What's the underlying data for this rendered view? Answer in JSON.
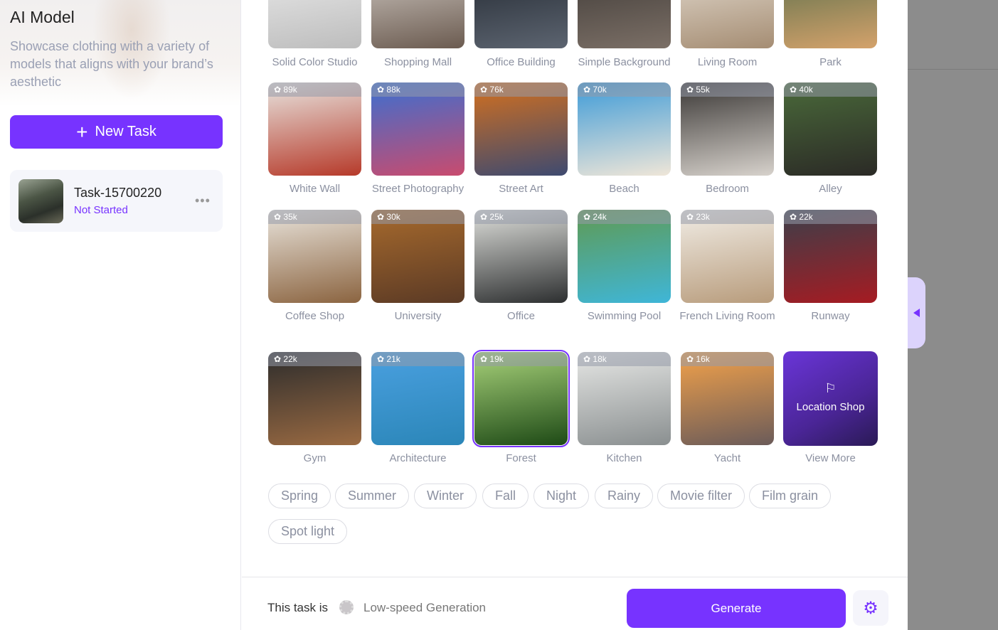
{
  "sidebar": {
    "title": "AI Model",
    "description": "Showcase clothing with a variety of models that aligns with your brand’s aesthetic",
    "new_task_label": "New Task",
    "task": {
      "name": "Task-15700220",
      "status": "Not Started"
    }
  },
  "scenes": [
    {
      "label": "Solid Color Studio",
      "count": "",
      "colors": [
        "#eeeeee",
        "#bdbdbd"
      ]
    },
    {
      "label": "Shopping Mall",
      "count": "",
      "colors": [
        "#d8d2cc",
        "#6b5b50"
      ]
    },
    {
      "label": "Office Building",
      "count": "",
      "colors": [
        "#1e242c",
        "#5c6470"
      ]
    },
    {
      "label": "Simple Background",
      "count": "",
      "colors": [
        "#3a3633",
        "#7b6f66"
      ]
    },
    {
      "label": "Living Room",
      "count": "",
      "colors": [
        "#e9e2d8",
        "#a58d73"
      ]
    },
    {
      "label": "Park",
      "count": "",
      "colors": [
        "#4f6a48",
        "#d4a26b"
      ]
    },
    {
      "label": "White Wall",
      "count": "89k",
      "colors": [
        "#e8e4df",
        "#b63a2a"
      ]
    },
    {
      "label": "Street Photography",
      "count": "88k",
      "colors": [
        "#3b6fd1",
        "#c94b6e"
      ]
    },
    {
      "label": "Street Art",
      "count": "76k",
      "colors": [
        "#d4701e",
        "#3e4a70"
      ]
    },
    {
      "label": "Beach",
      "count": "70k",
      "colors": [
        "#3d9bd8",
        "#efe6d8"
      ]
    },
    {
      "label": "Bedroom",
      "count": "55k",
      "colors": [
        "#3a3735",
        "#d7d2cc"
      ]
    },
    {
      "label": "Alley",
      "count": "40k",
      "colors": [
        "#4a6a3a",
        "#2b2a26"
      ]
    },
    {
      "label": "Coffee Shop",
      "count": "35k",
      "colors": [
        "#e9e4dc",
        "#8b6440"
      ]
    },
    {
      "label": "University",
      "count": "30k",
      "colors": [
        "#a76a2d",
        "#5b3a25"
      ]
    },
    {
      "label": "Office",
      "count": "25k",
      "colors": [
        "#dfe0dc",
        "#2d2f30"
      ]
    },
    {
      "label": "Swimming Pool",
      "count": "24k",
      "colors": [
        "#5f9a52",
        "#3fb6d8"
      ]
    },
    {
      "label": "French Living Room",
      "count": "23k",
      "colors": [
        "#f1ede6",
        "#b89c7c"
      ]
    },
    {
      "label": "Runway",
      "count": "22k",
      "colors": [
        "#3b3f4a",
        "#a61b22"
      ]
    },
    {
      "label": "Gym",
      "count": "22k",
      "colors": [
        "#2c2c2c",
        "#9a6a42"
      ]
    },
    {
      "label": "Architecture",
      "count": "21k",
      "colors": [
        "#4aa0e0",
        "#2b86b8"
      ]
    },
    {
      "label": "Forest",
      "count": "19k",
      "colors": [
        "#a8d27a",
        "#1e4a16"
      ]
    },
    {
      "label": "Kitchen",
      "count": "18k",
      "colors": [
        "#e6e7e5",
        "#8a8f90"
      ]
    },
    {
      "label": "Yacht",
      "count": "16k",
      "colors": [
        "#f3a24a",
        "#6b5b59"
      ]
    }
  ],
  "view_more": {
    "tile_label": "Location Shop",
    "label": "View More",
    "icon": "flag-icon"
  },
  "selected_scene": "Forest",
  "chips": [
    "Spring",
    "Summer",
    "Winter",
    "Fall",
    "Night",
    "Rainy",
    "Movie filter",
    "Film grain",
    "Spot light"
  ],
  "footer": {
    "prefix": "This task is",
    "speed": "Low-speed Generation",
    "generate_label": "Generate"
  },
  "colors": {
    "accent": "#7733ff"
  }
}
